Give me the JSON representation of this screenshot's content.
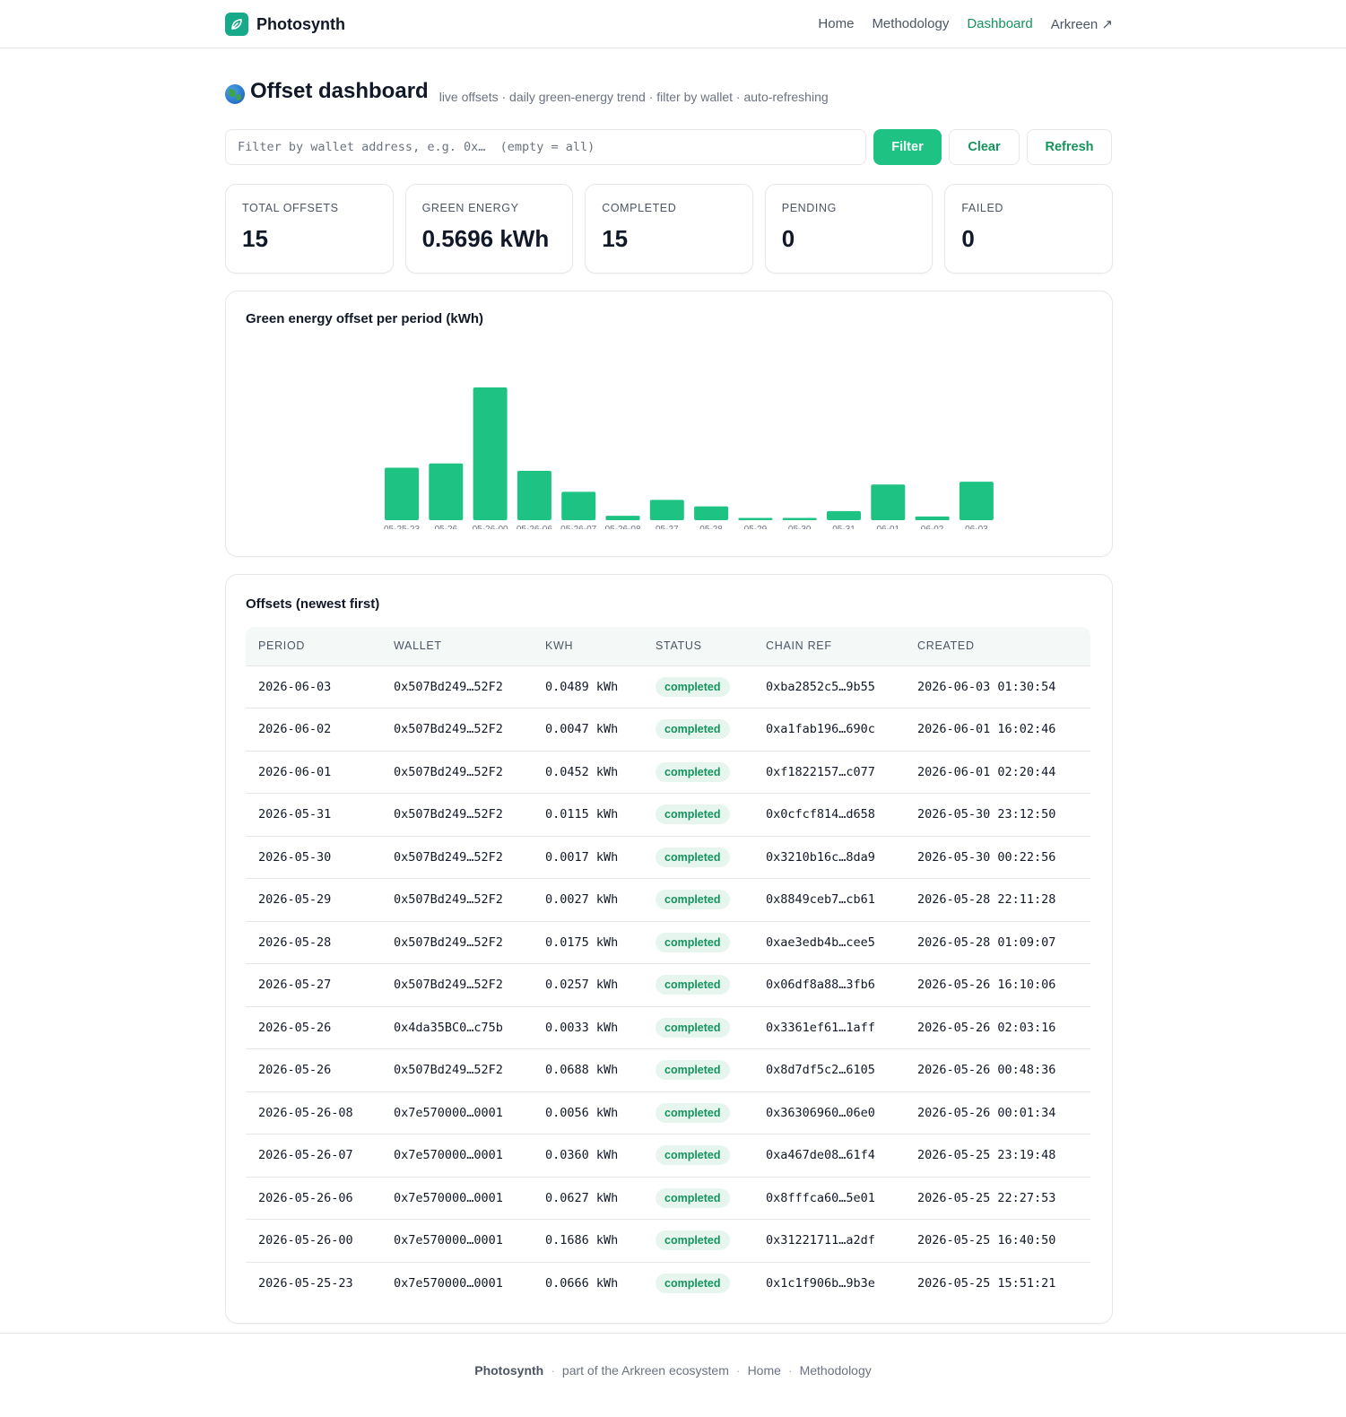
{
  "brand": {
    "name": "Photosynth",
    "logo_icon": "leaf-icon",
    "accent": "#16a98a"
  },
  "nav": {
    "items": [
      {
        "label": "Home"
      },
      {
        "label": "Methodology"
      },
      {
        "label": "Dashboard",
        "active": true
      },
      {
        "label": "Arkreen ↗"
      }
    ]
  },
  "page": {
    "title": "Offset dashboard",
    "title_icon": "globe-icon",
    "subtitle": "live offsets · daily green-energy trend · filter by wallet · auto-refreshing"
  },
  "filter": {
    "placeholder": "Filter by wallet address, e.g. 0x…  (empty = all)",
    "value": "",
    "filter_label": "Filter",
    "clear_label": "Clear",
    "refresh_label": "Refresh"
  },
  "stats": [
    {
      "label": "TOTAL OFFSETS",
      "value": "15"
    },
    {
      "label": "GREEN ENERGY",
      "value": "0.5696 kWh"
    },
    {
      "label": "COMPLETED",
      "value": "15"
    },
    {
      "label": "PENDING",
      "value": "0"
    },
    {
      "label": "FAILED",
      "value": "0"
    }
  ],
  "chart": {
    "title": "Green energy offset per period (kWh)",
    "bar_color": "#1ec383"
  },
  "chart_data": {
    "type": "bar",
    "title": "Green energy offset per period (kWh)",
    "xlabel": "",
    "ylabel": "",
    "categories": [
      "05-25-23",
      "05-26",
      "05-26-00",
      "05-26-06",
      "05-26-07",
      "05-26-08",
      "05-27",
      "05-28",
      "05-29",
      "05-30",
      "05-31",
      "06-01",
      "06-02",
      "06-03"
    ],
    "values": [
      0.0666,
      0.0721,
      0.1686,
      0.0627,
      0.036,
      0.0056,
      0.0257,
      0.0175,
      0.0027,
      0.0017,
      0.0115,
      0.0452,
      0.0047,
      0.0489
    ],
    "ylim": [
      0,
      0.1686
    ],
    "grid": false
  },
  "table": {
    "title": "Offsets (newest first)",
    "columns": [
      "PERIOD",
      "WALLET",
      "KWH",
      "STATUS",
      "CHAIN REF",
      "CREATED"
    ],
    "rows": [
      {
        "period": "2026-06-03",
        "wallet": "0x507Bd249…52F2",
        "kwh": "0.0489 kWh",
        "status": "completed",
        "chain_ref": "0xba2852c5…9b55",
        "created": "2026-06-03 01:30:54"
      },
      {
        "period": "2026-06-02",
        "wallet": "0x507Bd249…52F2",
        "kwh": "0.0047 kWh",
        "status": "completed",
        "chain_ref": "0xa1fab196…690c",
        "created": "2026-06-01 16:02:46"
      },
      {
        "period": "2026-06-01",
        "wallet": "0x507Bd249…52F2",
        "kwh": "0.0452 kWh",
        "status": "completed",
        "chain_ref": "0xf1822157…c077",
        "created": "2026-06-01 02:20:44"
      },
      {
        "period": "2026-05-31",
        "wallet": "0x507Bd249…52F2",
        "kwh": "0.0115 kWh",
        "status": "completed",
        "chain_ref": "0x0cfcf814…d658",
        "created": "2026-05-30 23:12:50"
      },
      {
        "period": "2026-05-30",
        "wallet": "0x507Bd249…52F2",
        "kwh": "0.0017 kWh",
        "status": "completed",
        "chain_ref": "0x3210b16c…8da9",
        "created": "2026-05-30 00:22:56"
      },
      {
        "period": "2026-05-29",
        "wallet": "0x507Bd249…52F2",
        "kwh": "0.0027 kWh",
        "status": "completed",
        "chain_ref": "0x8849ceb7…cb61",
        "created": "2026-05-28 22:11:28"
      },
      {
        "period": "2026-05-28",
        "wallet": "0x507Bd249…52F2",
        "kwh": "0.0175 kWh",
        "status": "completed",
        "chain_ref": "0xae3edb4b…cee5",
        "created": "2026-05-28 01:09:07"
      },
      {
        "period": "2026-05-27",
        "wallet": "0x507Bd249…52F2",
        "kwh": "0.0257 kWh",
        "status": "completed",
        "chain_ref": "0x06df8a88…3fb6",
        "created": "2026-05-26 16:10:06"
      },
      {
        "period": "2026-05-26",
        "wallet": "0x4da35BC0…c75b",
        "kwh": "0.0033 kWh",
        "status": "completed",
        "chain_ref": "0x3361ef61…1aff",
        "created": "2026-05-26 02:03:16"
      },
      {
        "period": "2026-05-26",
        "wallet": "0x507Bd249…52F2",
        "kwh": "0.0688 kWh",
        "status": "completed",
        "chain_ref": "0x8d7df5c2…6105",
        "created": "2026-05-26 00:48:36"
      },
      {
        "period": "2026-05-26-08",
        "wallet": "0x7e570000…0001",
        "kwh": "0.0056 kWh",
        "status": "completed",
        "chain_ref": "0x36306960…06e0",
        "created": "2026-05-26 00:01:34"
      },
      {
        "period": "2026-05-26-07",
        "wallet": "0x7e570000…0001",
        "kwh": "0.0360 kWh",
        "status": "completed",
        "chain_ref": "0xa467de08…61f4",
        "created": "2026-05-25 23:19:48"
      },
      {
        "period": "2026-05-26-06",
        "wallet": "0x7e570000…0001",
        "kwh": "0.0627 kWh",
        "status": "completed",
        "chain_ref": "0x8fffca60…5e01",
        "created": "2026-05-25 22:27:53"
      },
      {
        "period": "2026-05-26-00",
        "wallet": "0x7e570000…0001",
        "kwh": "0.1686 kWh",
        "status": "completed",
        "chain_ref": "0x31221711…a2df",
        "created": "2026-05-25 16:40:50"
      },
      {
        "period": "2026-05-25-23",
        "wallet": "0x7e570000…0001",
        "kwh": "0.0666 kWh",
        "status": "completed",
        "chain_ref": "0x1c1f906b…9b3e",
        "created": "2026-05-25 15:51:21"
      }
    ]
  },
  "footer": {
    "brand": "Photosynth",
    "tagline": "part of the Arkreen ecosystem",
    "links": [
      "Home",
      "Methodology"
    ],
    "separator": "·"
  }
}
